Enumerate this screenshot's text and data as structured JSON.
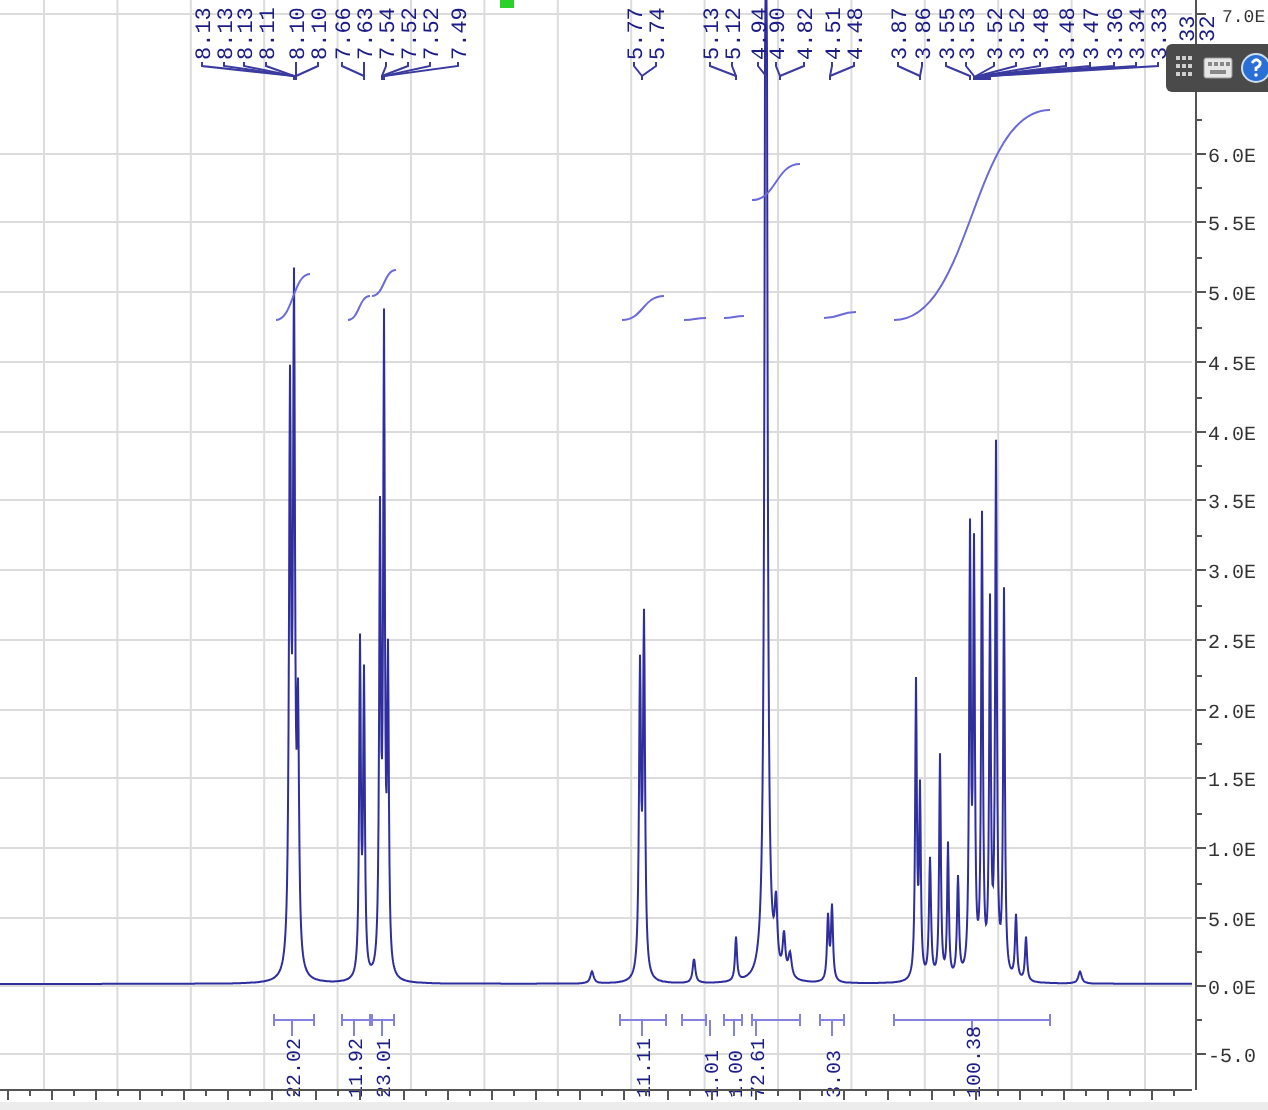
{
  "peak_labels": [
    "8.13",
    "8.13",
    "8.13",
    "8.11",
    "8.10",
    "8.10",
    "7.66",
    "7.63",
    "7.54",
    "7.52",
    "7.52",
    "7.49",
    "5.77",
    "5.74",
    "5.13",
    "5.12",
    "4.94",
    "4.90",
    "4.82",
    "4.51",
    "4.48",
    "3.87",
    "3.86",
    "3.55",
    "3.53",
    "3.52",
    "3.52",
    "3.48",
    "3.48",
    "3.47",
    "3.36",
    "3.34",
    "3.33",
    "33",
    "32"
  ],
  "integrals": [
    "22.02",
    "11.92",
    "23.01",
    "11.11",
    "1.01",
    "1.00",
    "72.61",
    "3.03",
    "100.38"
  ],
  "y_axis": {
    "tick_labels": [
      "7.0E",
      "6.0E",
      "5.5E",
      "5.0E",
      "4.5E",
      "4.0E",
      "3.5E",
      "3.0E",
      "2.5E",
      "2.0E",
      "1.5E",
      "1.0E",
      "5.0E",
      "0.0E",
      "-5.0"
    ]
  }
}
